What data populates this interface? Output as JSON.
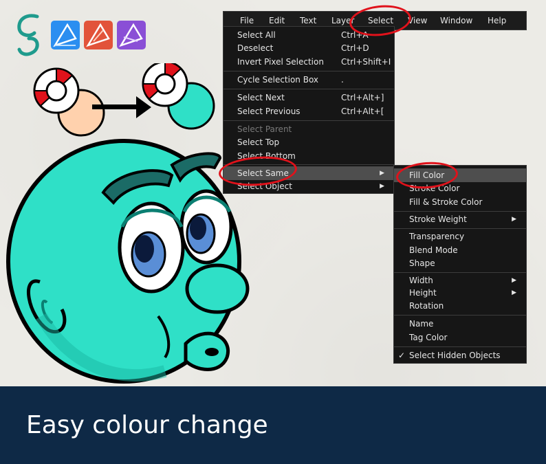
{
  "menubar": {
    "items": [
      "File",
      "Edit",
      "Text",
      "Layer",
      "Select",
      "View",
      "Window",
      "Help"
    ]
  },
  "select_menu": {
    "items": [
      {
        "label": "Select All",
        "shortcut": "Ctrl+A"
      },
      {
        "label": "Deselect",
        "shortcut": "Ctrl+D"
      },
      {
        "label": "Invert Pixel Selection",
        "shortcut": "Ctrl+Shift+I"
      },
      {
        "label": "Cycle Selection Box",
        "shortcut": "."
      },
      {
        "label": "Select Next",
        "shortcut": "Ctrl+Alt+]"
      },
      {
        "label": "Select Previous",
        "shortcut": "Ctrl+Alt+["
      },
      {
        "label": "Select Parent",
        "shortcut": ""
      },
      {
        "label": "Select Top",
        "shortcut": ""
      },
      {
        "label": "Select Bottom",
        "shortcut": ""
      },
      {
        "label": "Select Same",
        "shortcut": ""
      },
      {
        "label": "Select Object",
        "shortcut": ""
      }
    ]
  },
  "select_same_submenu": {
    "items": [
      "Fill Color",
      "Stroke Color",
      "Fill & Stroke Color",
      "Stroke Weight",
      "Transparency",
      "Blend Mode",
      "Shape",
      "Width",
      "Height",
      "Rotation",
      "Name",
      "Tag Color",
      "Select Hidden Objects"
    ],
    "check_glyph": "✓"
  },
  "banner": {
    "text": "Easy colour change"
  },
  "colors": {
    "accent_red": "#e0121b",
    "banner_bg": "#0e2946",
    "character_fill": "#2fe0c7",
    "peach": "#ffd1ad",
    "menu_bg": "#161616"
  },
  "icons": [
    "gs-logo-icon",
    "affinity-designer-icon",
    "affinity-publisher-icon",
    "affinity-photo-icon",
    "arrow-right-icon",
    "lifebuoy-icon"
  ]
}
